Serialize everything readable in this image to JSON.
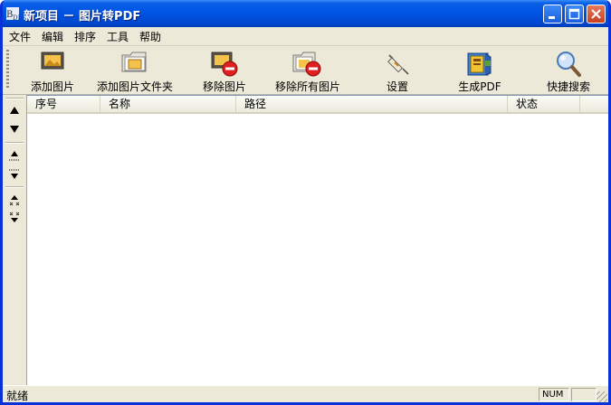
{
  "window": {
    "title": "新项目 － 图片转PDF"
  },
  "menu": [
    "文件",
    "编辑",
    "排序",
    "工具",
    "帮助"
  ],
  "toolbar": {
    "add_image": "添加图片",
    "add_folder": "添加图片文件夹",
    "remove_image": "移除图片",
    "remove_all": "移除所有图片",
    "settings": "设置",
    "generate_pdf": "生成PDF",
    "quick_search": "快捷搜索"
  },
  "list": {
    "columns": [
      "序号",
      "名称",
      "路径",
      "状态"
    ],
    "rows": []
  },
  "status": {
    "text": "就绪",
    "num": "NUM"
  }
}
